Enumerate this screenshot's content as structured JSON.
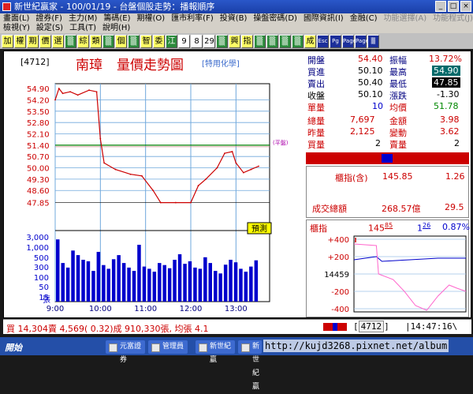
{
  "window": {
    "title": "新世紀贏家 - 100/01/19 - 台盤個股走勢：播報順序",
    "buttons": [
      "_",
      "□",
      "×"
    ]
  },
  "menu": {
    "row1": [
      "畫面(L)",
      "證券(F)",
      "主力(M)",
      "籌碼(E)",
      "期權(O)",
      "匯市利率(F)",
      "投資(B)",
      "操盤密碼(D)",
      "國際資訊(I)",
      "金融(C)",
      "功能選擇(A)",
      "功能程式(J)"
    ],
    "row2": [
      "檢視(Y)",
      "設定(S)",
      "工具(T)",
      "說明(H)"
    ]
  },
  "toolbar": {
    "items": [
      {
        "label": "加",
        "style": "y"
      },
      {
        "label": "權",
        "style": "y"
      },
      {
        "label": "期",
        "style": "y"
      },
      {
        "label": "價",
        "style": "y"
      },
      {
        "label": "選",
        "style": "y"
      },
      {
        "label": "▒",
        "style": "g"
      },
      {
        "label": "綜",
        "style": "y"
      },
      {
        "label": "類",
        "style": "y"
      },
      {
        "label": "▒",
        "style": "g"
      },
      {
        "label": "個",
        "style": "y"
      },
      {
        "label": "▒",
        "style": "g"
      },
      {
        "label": "智",
        "style": "y"
      },
      {
        "label": "委",
        "style": "y"
      },
      {
        "label": "江",
        "style": "g"
      },
      {
        "label": "9",
        "style": "num"
      },
      {
        "label": "8",
        "style": "num"
      },
      {
        "label": "29",
        "style": "num"
      },
      {
        "label": "▒",
        "style": "g"
      },
      {
        "label": "興",
        "style": "y"
      },
      {
        "label": "指",
        "style": "y"
      },
      {
        "label": "▒",
        "style": "g"
      },
      {
        "label": "▒",
        "style": "g"
      },
      {
        "label": "▒",
        "style": "g"
      },
      {
        "label": "▒",
        "style": "g"
      },
      {
        "label": "成",
        "style": "y"
      },
      {
        "label": "Esc",
        "style": "b"
      },
      {
        "label": "Pg",
        "style": "b"
      },
      {
        "label": "Page",
        "style": "b"
      },
      {
        "label": "Page",
        "style": "b"
      },
      {
        "label": "▒",
        "style": "b"
      }
    ]
  },
  "chart_header": {
    "code": "[4712]",
    "stock_name": "南璋",
    "chart_name": "量價走勢圖",
    "industry": "[特用化學]",
    "ref_label": "(平盤)"
  },
  "chart_data": [
    {
      "type": "line",
      "title": "量價走勢圖",
      "ylim": [
        47.0,
        55.2
      ],
      "yticks": [
        "54.90",
        "54.20",
        "53.50",
        "52.80",
        "52.10",
        "51.40",
        "50.70",
        "50.00",
        "49.30",
        "48.60",
        "47.85"
      ],
      "reference_price": 51.4,
      "xticks": [
        "9:00",
        "10:00",
        "11:00",
        "12:00",
        "13:00"
      ],
      "series": [
        {
          "x": [
            "9:00",
            "9:05",
            "9:10",
            "9:20",
            "9:30",
            "9:45",
            "9:55",
            "10:00",
            "10:05",
            "10:20",
            "10:40",
            "10:55",
            "11:10",
            "11:20",
            "11:40",
            "12:00",
            "12:10",
            "12:20",
            "12:35",
            "12:45",
            "12:55",
            "13:00",
            "13:10",
            "13:20",
            "13:30"
          ],
          "values": [
            54.2,
            54.9,
            54.6,
            54.7,
            54.5,
            54.8,
            54.7,
            51.8,
            50.3,
            49.9,
            49.6,
            49.5,
            48.6,
            47.85,
            47.85,
            47.85,
            48.9,
            49.3,
            50.0,
            50.9,
            51.0,
            50.3,
            49.7,
            49.9,
            50.1
          ]
        }
      ]
    },
    {
      "type": "bar",
      "title": "",
      "ylabel": "張",
      "yticks": [
        "3,000",
        "1,000",
        "500",
        "300",
        "100",
        "50",
        "15"
      ],
      "xticks": [
        "9:00",
        "10:00",
        "11:00",
        "12:00",
        "13:00"
      ],
      "series": [
        {
          "values": [
            2400,
            300,
            200,
            900,
            600,
            400,
            350,
            150,
            800,
            250,
            180,
            420,
            600,
            300,
            200,
            150,
            1500,
            220,
            180,
            140,
            300,
            250,
            190,
            400,
            650,
            280,
            350,
            200,
            180,
            500,
            300,
            150,
            120,
            260,
            400,
            320,
            180,
            140,
            220,
            380
          ]
        }
      ]
    }
  ],
  "quote": {
    "open_label": "開盤",
    "open": "54.40",
    "amp_label": "振幅",
    "amp": "13.72%",
    "bid_label": "買進",
    "bid": "50.10",
    "high_label": "最高",
    "high": "54.90",
    "ask_label": "賣出",
    "ask": "50.40",
    "low_label": "最低",
    "low": "47.85",
    "close_label": "收盤",
    "close": "50.10",
    "chg_label": "漲跌",
    "chg": "-1.30",
    "unit_label": "單量",
    "unit": "10",
    "avg_label": "均價",
    "avg": "51.78",
    "total_label": "總量",
    "total": "7,697",
    "amount_label": "金額",
    "amount": "3.98",
    "prev_label": "昨量",
    "prev": "2,125",
    "change_label": "變動",
    "change": "3.62",
    "buyvol_label": "買量",
    "buyvol": "2",
    "sellvol_label": "賣量",
    "sellvol": "2"
  },
  "index_box": {
    "label": "櫃指(含)",
    "value": "145.85",
    "change": "1.26",
    "turnover_label": "成交總額",
    "turnover": "268.57億",
    "turnover_chg": "29.5"
  },
  "mini_index": {
    "label": "櫃指",
    "value_main": "145",
    "value_dec": "85",
    "chg_main": "1",
    "chg_dec": "26",
    "pct": "0.87%",
    "yticks": [
      "+400",
      "+200",
      "14459",
      "-200",
      "-400"
    ]
  },
  "status": {
    "trade_text": "買 14,304賣 4,569( 0.32)成 910,330張, 均張 4.1",
    "code": "4712",
    "time": "14:47:16"
  },
  "taskbar": {
    "start": "開始",
    "items": [
      "元富證券",
      "管理員",
      "新世紀贏",
      "新世紀贏"
    ],
    "watermark": "http://kujd3268.pixnet.net/album"
  },
  "colors": {
    "price_line": "#cc0000",
    "volume_bar": "#0000cc",
    "grid": "#6fa8dc",
    "reference": "#008000"
  }
}
